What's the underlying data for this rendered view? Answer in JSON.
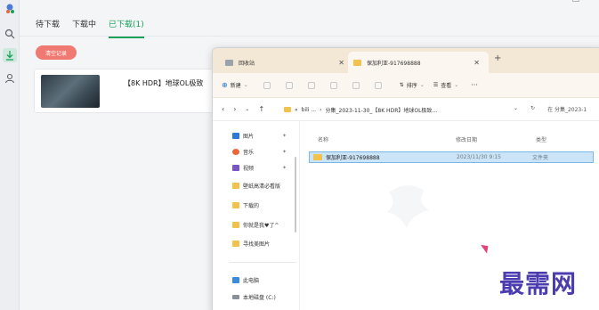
{
  "colors": {
    "accent": "#18a058",
    "clear_button": "#f07a72",
    "watermark": "#4b3db0"
  },
  "rail": {
    "icons": [
      "app-logo-icon",
      "search-icon",
      "download-icon",
      "user-icon"
    ]
  },
  "downloader": {
    "tabs": [
      {
        "label": "待下载",
        "active": false
      },
      {
        "label": "下载中",
        "active": false
      },
      {
        "label": "已下载(1)",
        "active": true
      }
    ],
    "clear_label": "清空记录",
    "item": {
      "title": "【8K HDR】地球OL极致"
    }
  },
  "explorer": {
    "tabs": [
      {
        "label": "回收站"
      },
      {
        "label": "保加利亚-917698888",
        "active": true
      }
    ],
    "toolbar": {
      "new_label": "新建",
      "sort_label": "排序",
      "view_label": "查看",
      "more_label": "···"
    },
    "address": {
      "crumbs": [
        "«",
        "bili ...",
        "›",
        "分集_2023-11-30_【8K HDR】地球OL极致..."
      ],
      "search_placeholder": "在 分集_2023-1"
    },
    "nav_items": [
      {
        "label": "图片",
        "icon": "pictures-icon",
        "color": "#2b79d8"
      },
      {
        "label": "音乐",
        "icon": "music-icon",
        "color": "#e8663a"
      },
      {
        "label": "视频",
        "icon": "videos-icon",
        "color": "#7a55c9"
      },
      {
        "label": "壁纸高清必看版",
        "icon": "folder-icon",
        "color": "#f2c14e"
      },
      {
        "label": "下载的",
        "icon": "folder-icon",
        "color": "#f2c14e"
      },
      {
        "label": "你就是我♥了^",
        "icon": "folder-icon",
        "color": "#f2c14e"
      },
      {
        "label": "寻找美图片",
        "icon": "folder-icon",
        "color": "#f2c14e"
      },
      {
        "label": "此电脑",
        "icon": "computer-icon",
        "color": "#3b8be0"
      },
      {
        "label": "本地磁盘 (C:)",
        "icon": "drive-icon",
        "color": "#8a9099"
      }
    ],
    "columns": {
      "name": "名称",
      "date": "修改日期",
      "type": "类型"
    },
    "rows": [
      {
        "name": "保加利亚-917698888",
        "date": "2023/11/30 9:15",
        "type": "文件夹"
      }
    ]
  },
  "watermark": "最需网"
}
